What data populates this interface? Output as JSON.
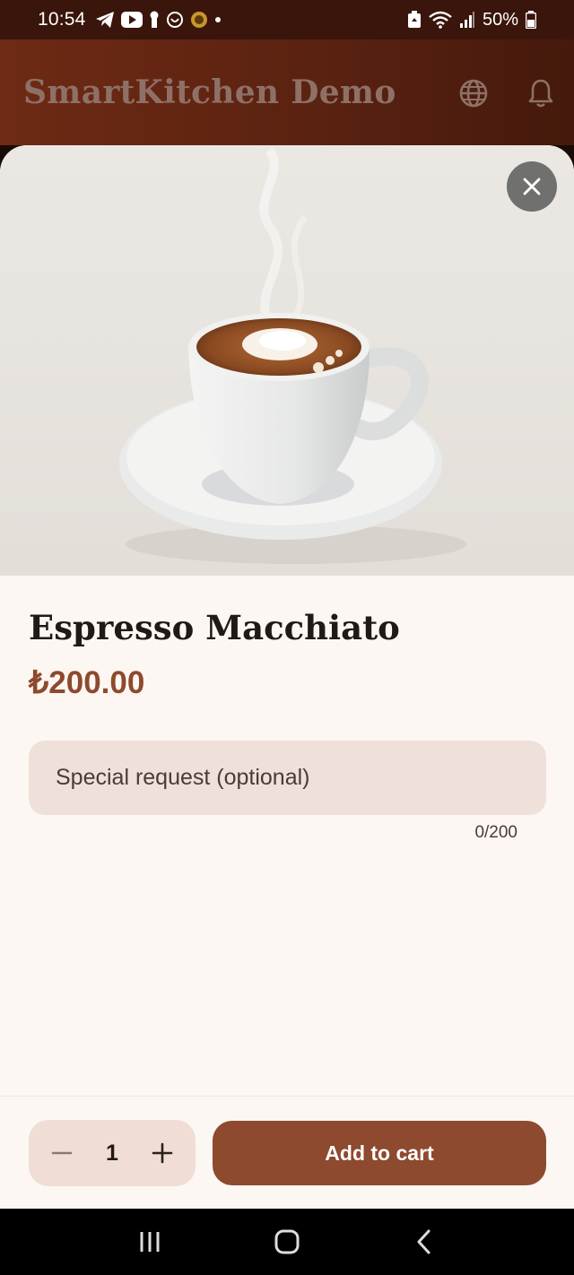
{
  "status_bar": {
    "time": "10:54",
    "battery": "50%",
    "left_icons": [
      "telegram-icon",
      "youtube-icon",
      "keyhole-icon",
      "heart-smiley-icon",
      "app-badge-icon",
      "dot-icon"
    ],
    "right_icons": [
      "battery-saver-icon",
      "wifi-icon",
      "signal-icon",
      "battery-icon"
    ]
  },
  "app_bar": {
    "title": "SmartKitchen Demo",
    "actions": [
      "globe-icon",
      "bell-icon"
    ]
  },
  "sheet": {
    "image": "espresso-macchiato-photo",
    "item_name": "Espresso Macchiato",
    "price": "₺200.00",
    "special_request": {
      "value": "",
      "placeholder": "Special request (optional)",
      "counter": "0/200"
    }
  },
  "actions": {
    "quantity": "1",
    "add_to_cart": "Add to cart"
  },
  "nav_bar": {
    "buttons": [
      "recents-icon",
      "home-icon",
      "back-icon"
    ]
  },
  "colors": {
    "status_bar": "#3a150b",
    "app_bar": "#6e2a14",
    "accent": "#8d4a2e",
    "field_bg": "#f0e0da",
    "sheet_bg": "#fdf7f3"
  }
}
